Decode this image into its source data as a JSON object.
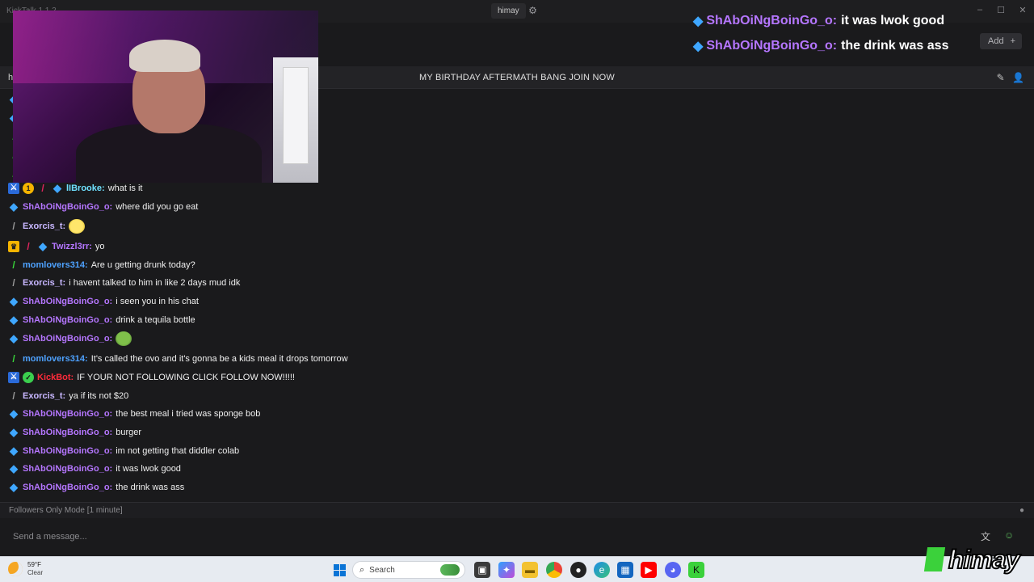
{
  "app": {
    "title": "KickTalk 1.1.2",
    "channel_tab": "himay",
    "add_label": "Add",
    "add_plus": "+"
  },
  "header": {
    "left_text": "h",
    "stream_title": "MY BIRTHDAY AFTERMATH BANG JOIN NOW"
  },
  "chat": {
    "messages": [
      {
        "user": "lIBrooke:",
        "text": "what is it"
      },
      {
        "user": "ShAbOiNgBoinGo_o:",
        "text": "where did you go eat"
      },
      {
        "user": "Exorcis_t:",
        "text": ""
      },
      {
        "user": "Twizzl3rr:",
        "text": "yo"
      },
      {
        "user": "momlovers314:",
        "text": "Are u getting drunk today?"
      },
      {
        "user": "Exorcis_t:",
        "text": "i havent talked to him in like 2 days mud idk"
      },
      {
        "user": "ShAbOiNgBoinGo_o:",
        "text": "i seen you in his chat"
      },
      {
        "user": "ShAbOiNgBoinGo_o:",
        "text": "drink a tequila bottle"
      },
      {
        "user": "ShAbOiNgBoinGo_o:",
        "text": ""
      },
      {
        "user": "momlovers314:",
        "text": "It's called the ovo and it's gonna be a kids meal it drops tomorrow"
      },
      {
        "user": "KickBot:",
        "text": "IF YOUR NOT FOLLOWING CLICK FOLLOW NOW!!!!!"
      },
      {
        "user": "Exorcis_t:",
        "text": "ya if its not $20"
      },
      {
        "user": "ShAbOiNgBoinGo_o:",
        "text": "the best meal i tried was sponge bob"
      },
      {
        "user": "ShAbOiNgBoinGo_o:",
        "text": "burger"
      },
      {
        "user": "ShAbOiNgBoinGo_o:",
        "text": "im not getting that diddler colab"
      },
      {
        "user": "ShAbOiNgBoinGo_o:",
        "text": "it was lwok good"
      },
      {
        "user": "ShAbOiNgBoinGo_o:",
        "text": "the drink was ass"
      }
    ]
  },
  "overlay": {
    "lines": [
      {
        "user": "ShAbOiNgBoinGo_o:",
        "text": "it was lwok good"
      },
      {
        "user": "ShAbOiNgBoinGo_o:",
        "text": "the drink was ass"
      }
    ]
  },
  "footer": {
    "mode_text": "Followers Only Mode [1 minute]",
    "input_placeholder": "Send a message..."
  },
  "watermark": {
    "text": "himay"
  },
  "taskbar": {
    "temperature": "59°F",
    "condition": "Clear",
    "search_label": "Search"
  },
  "colors": {
    "sub_badge": "#3fa7ff",
    "username_purple": "#b576ff",
    "username_blue": "#4ea2ff",
    "kickbot_red": "#ff2b3a",
    "kick_green": "#3bd13b"
  },
  "icons": {
    "gear": "gear-icon",
    "pencil": "pencil-icon",
    "user": "user-icon",
    "sub_badge": "cube-icon",
    "emote_picker": "emote-icon",
    "translate": "translate-icon"
  }
}
